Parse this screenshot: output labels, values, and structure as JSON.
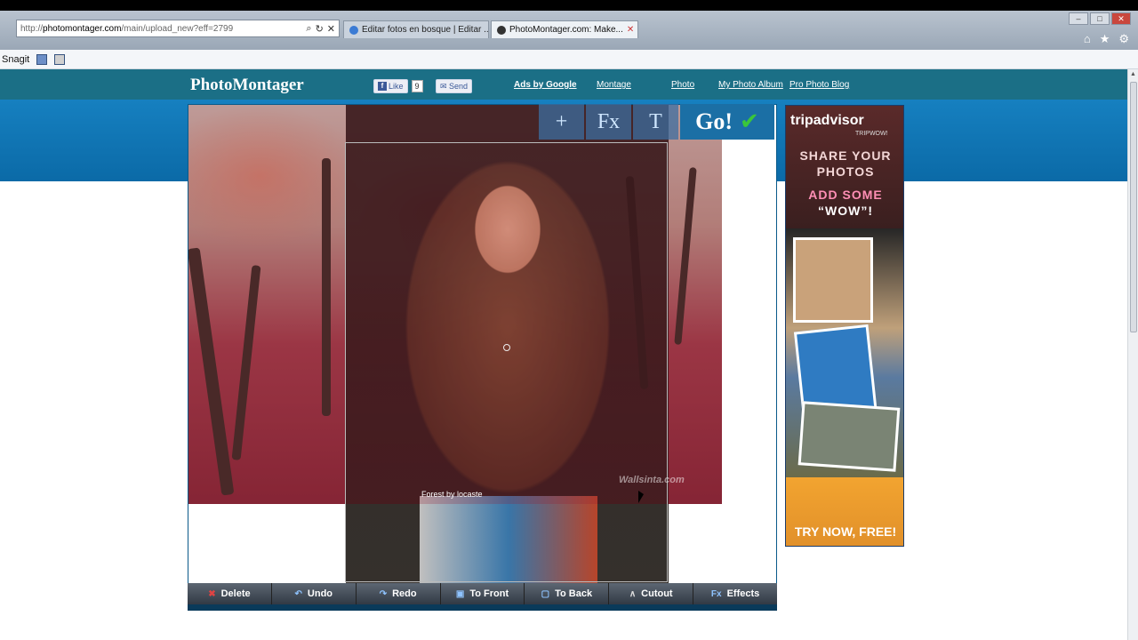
{
  "browser": {
    "url_prefix": "http://",
    "url_domain": "photomontager.com",
    "url_path": "/main/upload_new?eff=2799",
    "tabs": [
      {
        "label": "Editar fotos en bosque | Editar ...",
        "active": false
      },
      {
        "label": "PhotoMontager.com: Make...",
        "active": true
      }
    ],
    "toolbar_label": "Snagit"
  },
  "site": {
    "logo": "PhotoMontager",
    "like_label": "Like",
    "like_count": "9",
    "send_label": "Send",
    "nav": [
      "Ads by Google",
      "Montage",
      "Photo",
      "My Photo Album",
      "Pro Photo Blog"
    ]
  },
  "editor": {
    "tools": [
      "+",
      "Fx",
      "T"
    ],
    "go_label": "Go!",
    "caption": "Forest by locaste",
    "watermark": "Wallsinta.com",
    "actions": [
      "Delete",
      "Undo",
      "Redo",
      "To Front",
      "To Back",
      "Cutout",
      "Effects"
    ]
  },
  "ad": {
    "brand": "tripadvisor",
    "sub": "TRIPWOW!",
    "line1": "SHARE YOUR",
    "line2": "PHOTOS",
    "line3": "ADD SOME",
    "line4": "“WOW”!",
    "cta": "TRY NOW, FREE!"
  },
  "colors": {
    "accent": "#1680c0",
    "nav": "#1b6f86",
    "go_check": "#3ac63a"
  }
}
